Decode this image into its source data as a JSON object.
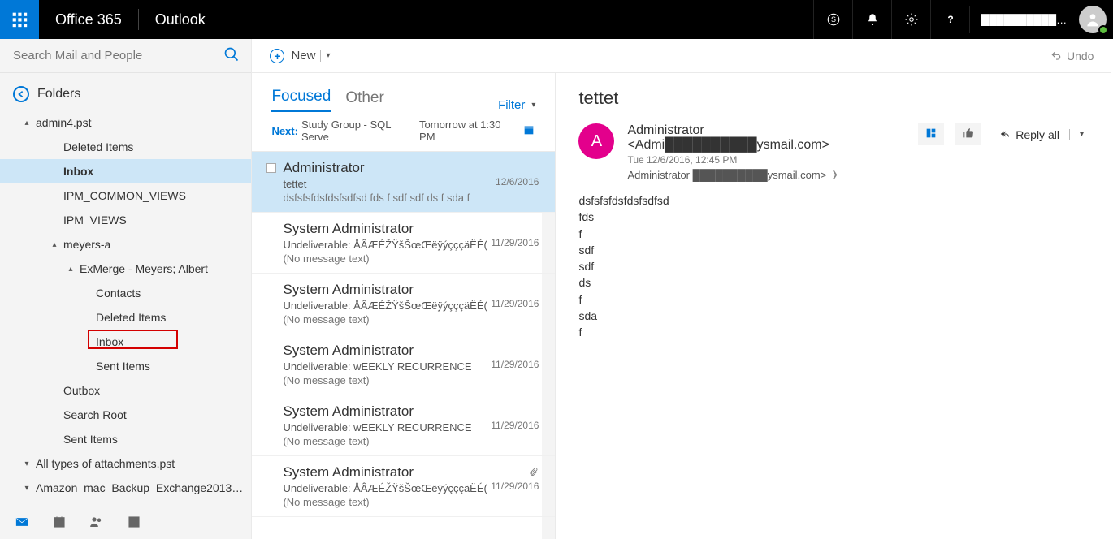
{
  "header": {
    "brand1": "Office 365",
    "brand2": "Outlook",
    "user_name": "████████████a"
  },
  "search": {
    "placeholder": "Search Mail and People"
  },
  "toolbar": {
    "new_label": "New",
    "undo_label": "Undo"
  },
  "folders": {
    "title": "Folders",
    "tree": [
      {
        "label": "admin4.pst",
        "depth": 0,
        "caret": "up"
      },
      {
        "label": "Deleted Items",
        "depth": 1
      },
      {
        "label": "Inbox",
        "depth": 1,
        "selected": true,
        "bold": true
      },
      {
        "label": "IPM_COMMON_VIEWS",
        "depth": 1
      },
      {
        "label": "IPM_VIEWS",
        "depth": 1
      },
      {
        "label": "meyers-a",
        "depth": 1,
        "caret": "up"
      },
      {
        "label": "ExMerge - Meyers; Albert",
        "depth": 2,
        "caret": "up"
      },
      {
        "label": "Contacts",
        "depth": 3,
        "highlight": true
      },
      {
        "label": "Deleted Items",
        "depth": 3
      },
      {
        "label": "Inbox",
        "depth": 3
      },
      {
        "label": "Sent Items",
        "depth": 3
      },
      {
        "label": "Outbox",
        "depth": 1
      },
      {
        "label": "Search Root",
        "depth": 1
      },
      {
        "label": "Sent Items",
        "depth": 1
      },
      {
        "label": "All types of attachments.pst",
        "depth": 0,
        "caret": "down"
      },
      {
        "label": "Amazon_mac_Backup_Exchange2013…",
        "depth": 0,
        "caret": "down"
      }
    ]
  },
  "tabs": {
    "focused": "Focused",
    "other": "Other",
    "filter": "Filter"
  },
  "next": {
    "label": "Next:",
    "text": "Study Group - SQL Serve",
    "time": "Tomorrow at 1:30 PM"
  },
  "messages": [
    {
      "from": "Administrator",
      "subject": "tettet",
      "preview": "dsfsfsfdsfdsfsdfsd fds f sdf sdf ds f sda f",
      "date": "12/6/2016",
      "selected": true,
      "checkbox": true
    },
    {
      "from": "System Administrator",
      "subject": "Undeliverable: ÅÂÆÉŽŸšŠœŒëÿýçççäËÉ(",
      "preview": "(No message text)",
      "date": "11/29/2016"
    },
    {
      "from": "System Administrator",
      "subject": "Undeliverable: ÅÂÆÉŽŸšŠœŒëÿýçççäËÉ(",
      "preview": "(No message text)",
      "date": "11/29/2016"
    },
    {
      "from": "System Administrator",
      "subject": "Undeliverable: wEEKLY RECURRENCE",
      "preview": "(No message text)",
      "date": "11/29/2016"
    },
    {
      "from": "System Administrator",
      "subject": "Undeliverable: wEEKLY RECURRENCE",
      "preview": "(No message text)",
      "date": "11/29/2016"
    },
    {
      "from": "System Administrator",
      "subject": "Undeliverable: ÅÂÆÉŽŸšŠœŒëÿýçççäËÉ(",
      "preview": "(No message text)",
      "date": "11/29/2016",
      "attachment": true
    }
  ],
  "reading": {
    "subject": "tettet",
    "avatar_initial": "A",
    "from": "Administrator <Admi██████████ysmail.com>",
    "date": "Tue 12/6/2016, 12:45 PM",
    "to": "Administrator ██████████ysmail.com>",
    "reply_all": "Reply all",
    "body": "dsfsfsfdsfdsfsdfsd\nfds\nf\nsdf\nsdf\nds\nf\nsda\nf"
  }
}
